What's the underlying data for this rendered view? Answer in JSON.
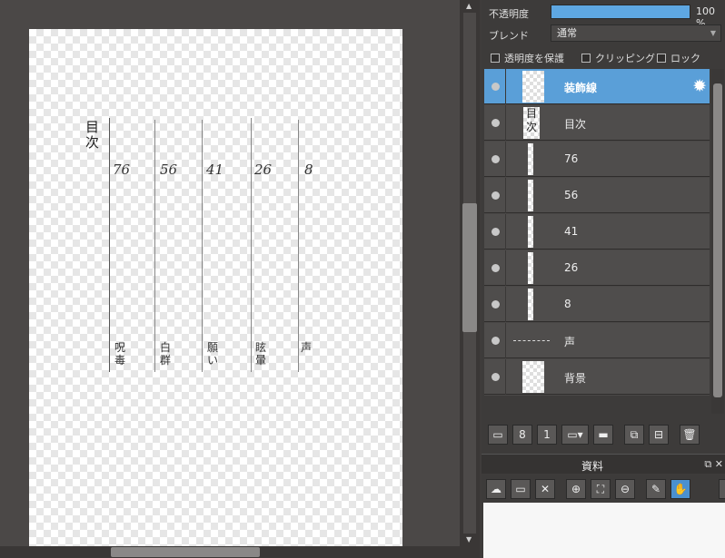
{
  "canvas": {
    "toc_title": "目次",
    "page_numbers": [
      "76",
      "56",
      "41",
      "26",
      "8"
    ],
    "chapters": [
      "呪毒",
      "白群",
      "願い",
      "眩暈",
      "声"
    ]
  },
  "layer_props": {
    "opacity_label": "不透明度",
    "opacity_value": "100 %",
    "opacity_fraction": 1.0,
    "blend_label": "ブレンド",
    "blend_value": "通常",
    "protect_alpha": "透明度を保護",
    "clipping": "クリッピング",
    "lock": "ロック"
  },
  "layers": [
    {
      "name": "装飾線",
      "selected": true
    },
    {
      "name": "目次",
      "selected": false
    },
    {
      "name": "76",
      "selected": false
    },
    {
      "name": "56",
      "selected": false
    },
    {
      "name": "41",
      "selected": false
    },
    {
      "name": "26",
      "selected": false
    },
    {
      "name": "8",
      "selected": false
    },
    {
      "name": "声",
      "selected": false
    },
    {
      "name": "背景",
      "selected": false
    }
  ],
  "materials": {
    "title": "資料"
  },
  "colors": {
    "selection": "#5a9fd8",
    "opacity_bar": "#5ea7e2"
  }
}
